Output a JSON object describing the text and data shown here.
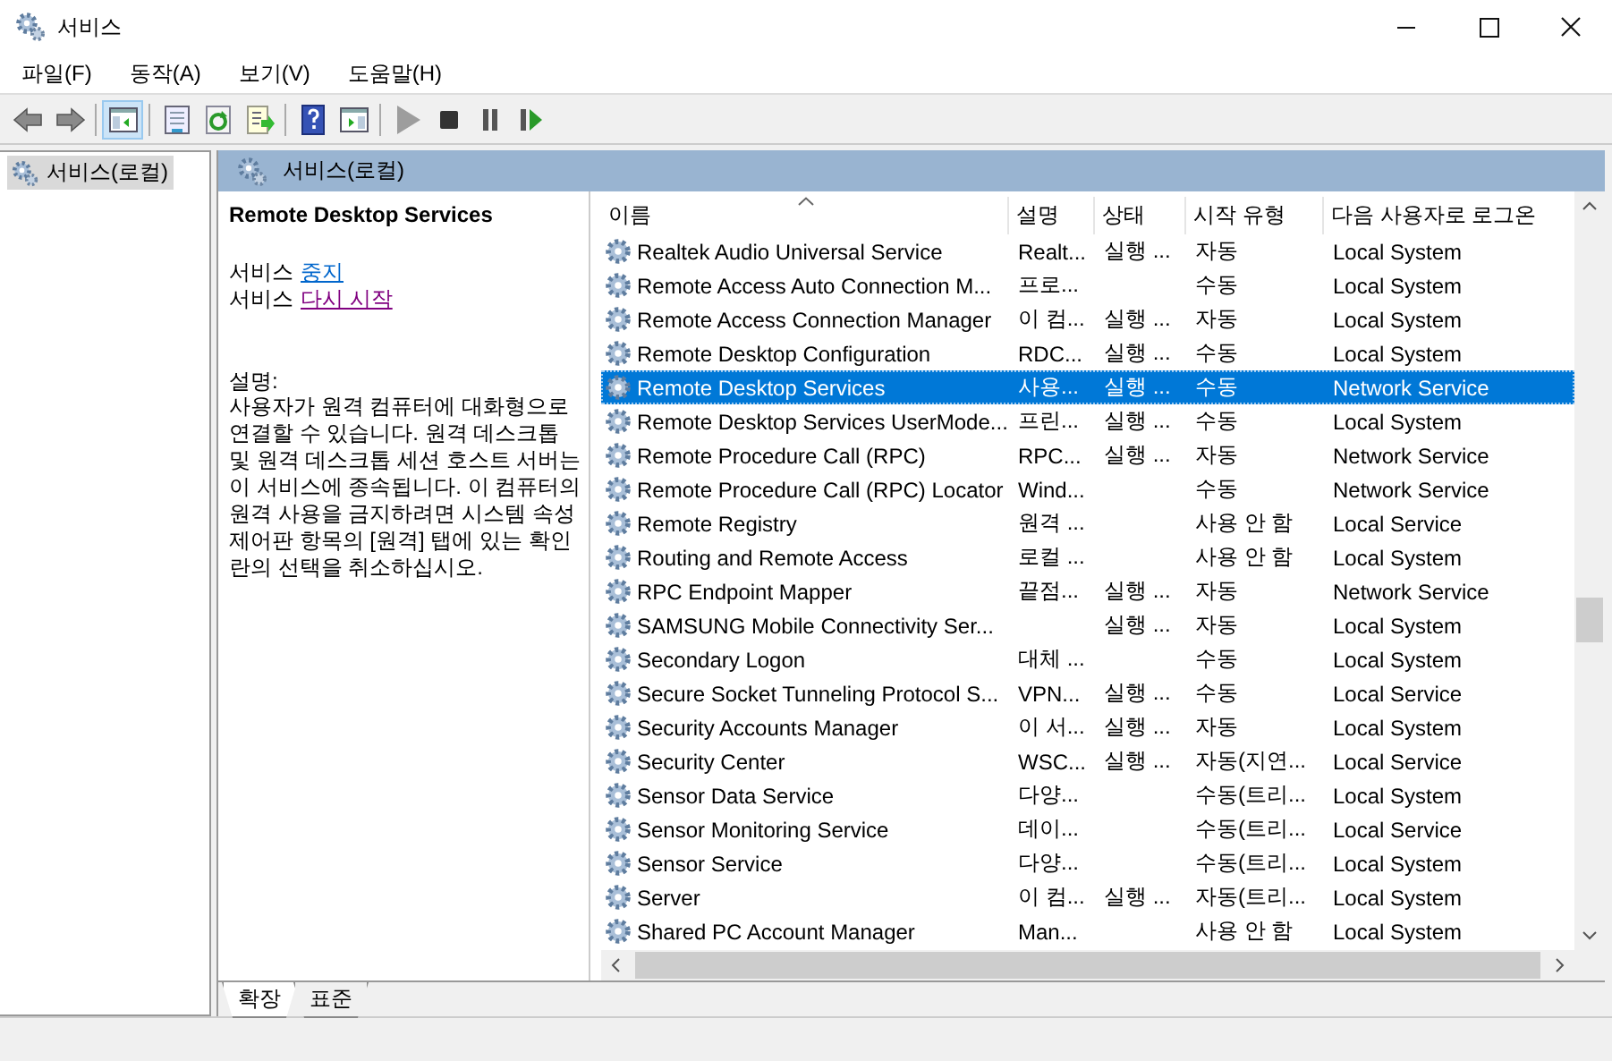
{
  "window": {
    "title": "서비스"
  },
  "menu": [
    {
      "label": "파일(F)"
    },
    {
      "label": "동작(A)"
    },
    {
      "label": "보기(V)"
    },
    {
      "label": "도움말(H)"
    }
  ],
  "toolbar": [
    {
      "kind": "back",
      "pressed": false,
      "disabled": false
    },
    {
      "kind": "forward",
      "pressed": false,
      "disabled": false
    },
    {
      "kind": "separator"
    },
    {
      "kind": "tree",
      "pressed": true,
      "disabled": false
    },
    {
      "kind": "separator"
    },
    {
      "kind": "properties",
      "pressed": false,
      "disabled": false
    },
    {
      "kind": "refresh",
      "pressed": false,
      "disabled": false
    },
    {
      "kind": "export",
      "pressed": false,
      "disabled": false
    },
    {
      "kind": "separator"
    },
    {
      "kind": "help",
      "pressed": false,
      "disabled": false
    },
    {
      "kind": "panel",
      "pressed": false,
      "disabled": false
    },
    {
      "kind": "separator"
    },
    {
      "kind": "play",
      "pressed": false,
      "disabled": true
    },
    {
      "kind": "stop",
      "pressed": false,
      "disabled": false
    },
    {
      "kind": "pause",
      "pressed": false,
      "disabled": false
    },
    {
      "kind": "resume",
      "pressed": false,
      "disabled": false
    }
  ],
  "tree": [
    {
      "label": "서비스(로컬)",
      "selected": true
    }
  ],
  "header": {
    "title": "서비스(로컬)"
  },
  "detail": {
    "service_name": "Remote Desktop Services",
    "actions": [
      {
        "prefix": "서비스",
        "link": "중지",
        "visited": false
      },
      {
        "prefix": "서비스",
        "link": "다시 시작",
        "visited": true
      }
    ],
    "description_label": "설명:",
    "description": "사용자가 원격 컴퓨터에 대화형으로 연결할 수 있습니다. 원격 데스크톱 및 원격 데스크톱 세션 호스트 서버는 이 서비스에 종속됩니다. 이 컴퓨터의 원격 사용을 금지하려면 시스템 속성 제어판 항목의 [원격] 탭에 있는 확인란의 선택을 취소하십시오."
  },
  "table": {
    "columns": [
      {
        "label": "이름",
        "sorted": true
      },
      {
        "label": "설명",
        "sorted": false
      },
      {
        "label": "상태",
        "sorted": false
      },
      {
        "label": "시작 유형",
        "sorted": false
      },
      {
        "label": "다음 사용자로 로그온",
        "sorted": false
      }
    ],
    "rows": [
      {
        "name": "Realtek Audio Universal Service",
        "description": "Realt...",
        "status": "실행 ...",
        "startup": "자동",
        "logon": "Local System",
        "selected": false
      },
      {
        "name": "Remote Access Auto Connection M...",
        "description": "프로...",
        "status": "",
        "startup": "수동",
        "logon": "Local System",
        "selected": false
      },
      {
        "name": "Remote Access Connection Manager",
        "description": "이 컴...",
        "status": "실행 ...",
        "startup": "자동",
        "logon": "Local System",
        "selected": false
      },
      {
        "name": "Remote Desktop Configuration",
        "description": "RDC...",
        "status": "실행 ...",
        "startup": "수동",
        "logon": "Local System",
        "selected": false
      },
      {
        "name": "Remote Desktop Services",
        "description": "사용...",
        "status": "실행 ...",
        "startup": "수동",
        "logon": "Network Service",
        "selected": true
      },
      {
        "name": "Remote Desktop Services UserMode...",
        "description": "프린...",
        "status": "실행 ...",
        "startup": "수동",
        "logon": "Local System",
        "selected": false
      },
      {
        "name": "Remote Procedure Call (RPC)",
        "description": "RPC...",
        "status": "실행 ...",
        "startup": "자동",
        "logon": "Network Service",
        "selected": false
      },
      {
        "name": "Remote Procedure Call (RPC) Locator",
        "description": "Wind...",
        "status": "",
        "startup": "수동",
        "logon": "Network Service",
        "selected": false
      },
      {
        "name": "Remote Registry",
        "description": "원격 ...",
        "status": "",
        "startup": "사용 안 함",
        "logon": "Local Service",
        "selected": false
      },
      {
        "name": "Routing and Remote Access",
        "description": "로컬 ...",
        "status": "",
        "startup": "사용 안 함",
        "logon": "Local System",
        "selected": false
      },
      {
        "name": "RPC Endpoint Mapper",
        "description": "끝점...",
        "status": "실행 ...",
        "startup": "자동",
        "logon": "Network Service",
        "selected": false
      },
      {
        "name": "SAMSUNG Mobile Connectivity Ser...",
        "description": "",
        "status": "실행 ...",
        "startup": "자동",
        "logon": "Local System",
        "selected": false
      },
      {
        "name": "Secondary Logon",
        "description": "대체 ...",
        "status": "",
        "startup": "수동",
        "logon": "Local System",
        "selected": false
      },
      {
        "name": "Secure Socket Tunneling Protocol S...",
        "description": "VPN...",
        "status": "실행 ...",
        "startup": "수동",
        "logon": "Local Service",
        "selected": false
      },
      {
        "name": "Security Accounts Manager",
        "description": "이 서...",
        "status": "실행 ...",
        "startup": "자동",
        "logon": "Local System",
        "selected": false
      },
      {
        "name": "Security Center",
        "description": "WSC...",
        "status": "실행 ...",
        "startup": "자동(지연...",
        "logon": "Local Service",
        "selected": false
      },
      {
        "name": "Sensor Data Service",
        "description": "다양...",
        "status": "",
        "startup": "수동(트리...",
        "logon": "Local System",
        "selected": false
      },
      {
        "name": "Sensor Monitoring Service",
        "description": "데이...",
        "status": "",
        "startup": "수동(트리...",
        "logon": "Local Service",
        "selected": false
      },
      {
        "name": "Sensor Service",
        "description": "다양...",
        "status": "",
        "startup": "수동(트리...",
        "logon": "Local System",
        "selected": false
      },
      {
        "name": "Server",
        "description": "이 컴...",
        "status": "실행 ...",
        "startup": "자동(트리...",
        "logon": "Local System",
        "selected": false
      },
      {
        "name": "Shared PC Account Manager",
        "description": "Man...",
        "status": "",
        "startup": "사용 안 함",
        "logon": "Local System",
        "selected": false
      }
    ]
  },
  "tabs": [
    {
      "label": "확장",
      "selected": true
    },
    {
      "label": "표준",
      "selected": false
    }
  ]
}
